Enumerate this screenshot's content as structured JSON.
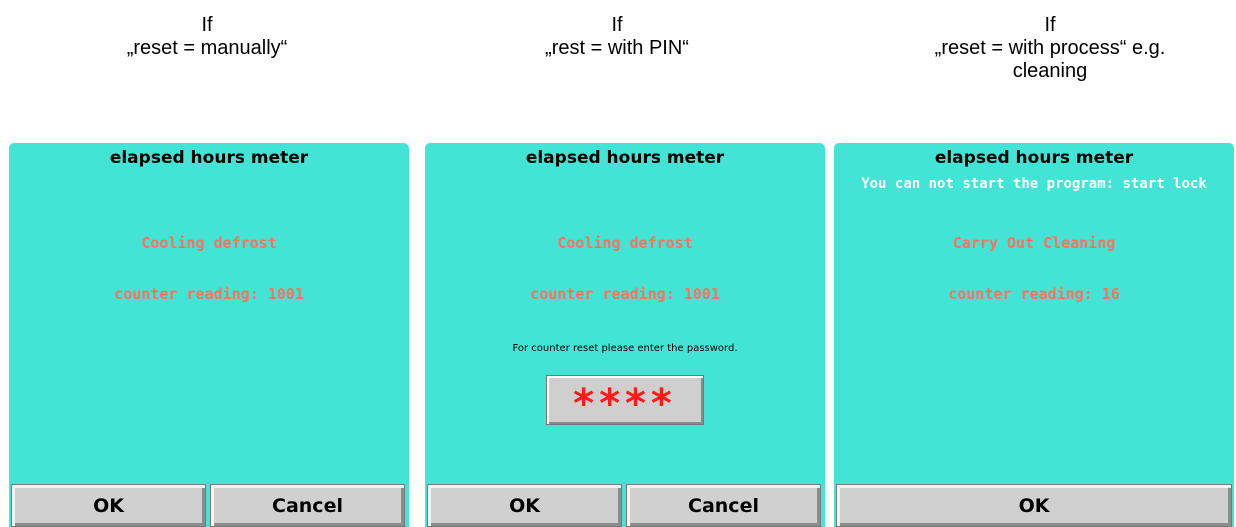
{
  "captions": [
    {
      "line1": "If",
      "line2": "„reset = manually“"
    },
    {
      "line1": "If",
      "line2": "„rest = with PIN“"
    },
    {
      "line1": "If",
      "line2": "„reset = with process“ e.g. cleaning"
    }
  ],
  "panels": [
    {
      "title": "elapsed hours meter",
      "line1": "Cooling defrost",
      "line2": "counter reading: 1001",
      "buttons": {
        "ok": "OK",
        "cancel": "Cancel"
      }
    },
    {
      "title": "elapsed hours meter",
      "line1": "Cooling defrost",
      "line2": "counter reading: 1001",
      "password_prompt": "For counter reset please enter the password.",
      "password_value": "****",
      "buttons": {
        "ok": "OK",
        "cancel": "Cancel"
      }
    },
    {
      "title": "elapsed hours meter",
      "warning": "You can not start the program: start lock",
      "line1": "Carry Out Cleaning",
      "line2": "counter reading: 16",
      "buttons": {
        "ok": "OK"
      }
    }
  ],
  "colors": {
    "panel_bg": "#43e4d6",
    "accent_text": "#ff6f5a",
    "warning_text": "#ffffff",
    "password_glyph": "#ff1a1a",
    "button_bg": "#d0d0d0"
  }
}
